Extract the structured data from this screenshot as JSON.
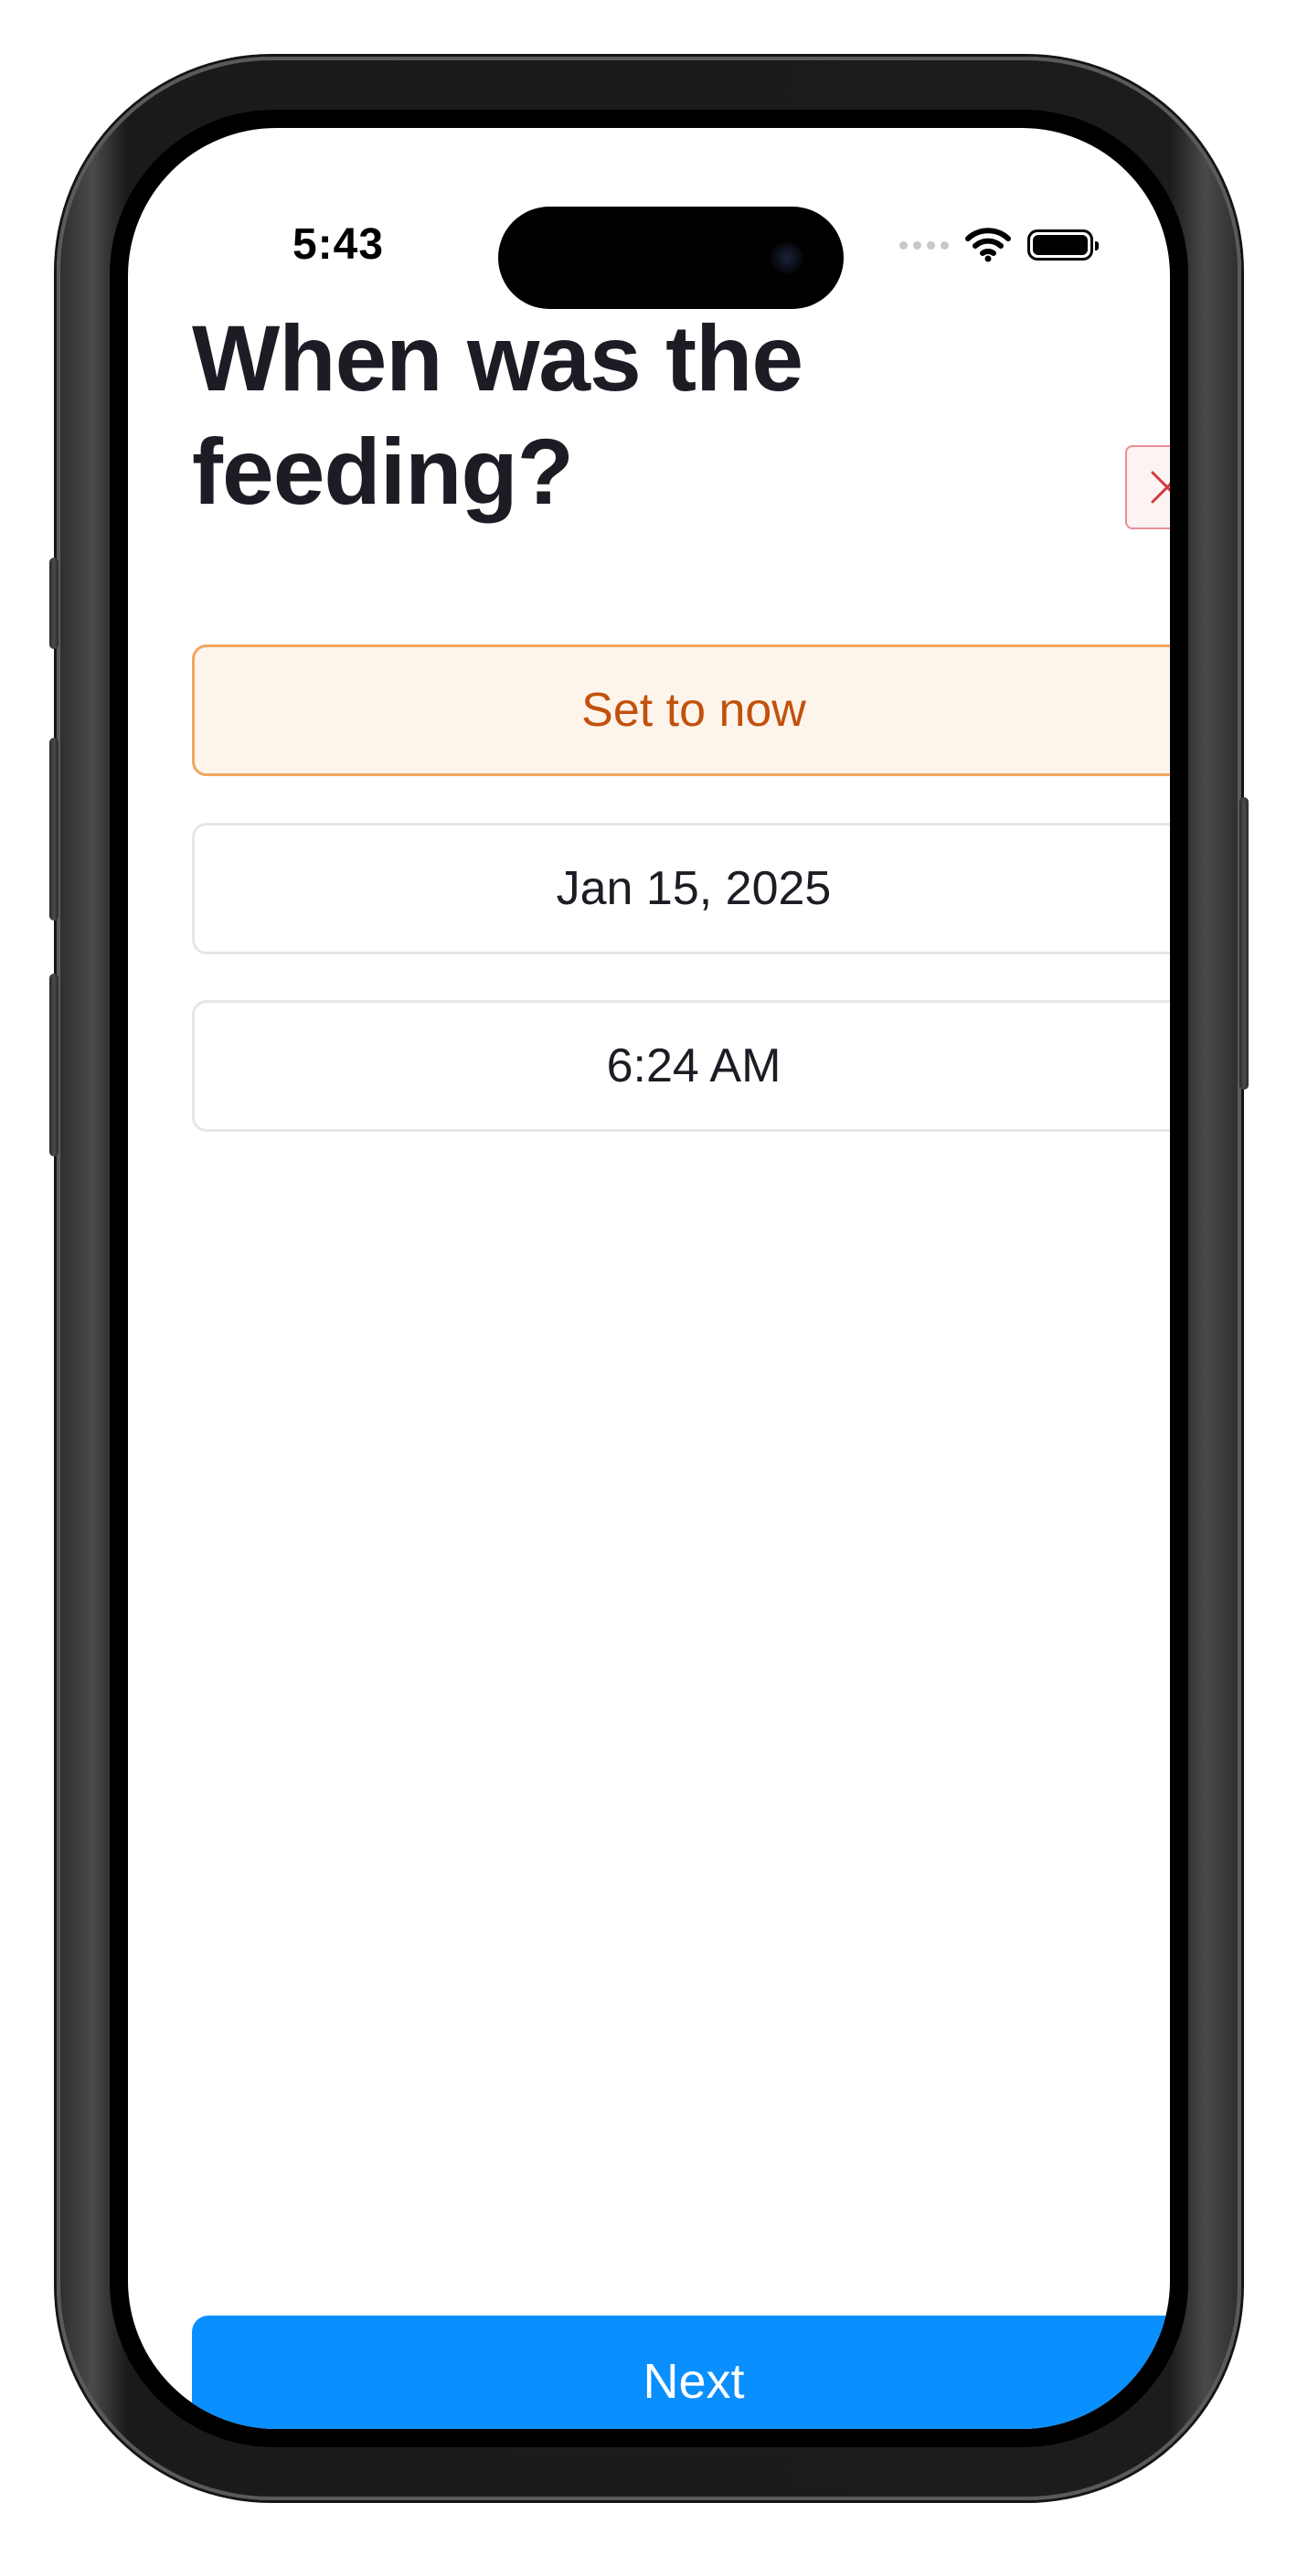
{
  "status_bar": {
    "time": "5:43"
  },
  "screen": {
    "title": "When was the feeding?",
    "close_icon": "close-icon",
    "set_now_label": "Set to now",
    "date_value": "Jan 15, 2025",
    "time_value": "6:24 AM",
    "next_label": "Next"
  },
  "colors": {
    "accent_orange": "#c2510c",
    "orange_border": "#f0a75e",
    "primary_blue": "#0a8fff",
    "close_red": "#d23b43"
  }
}
